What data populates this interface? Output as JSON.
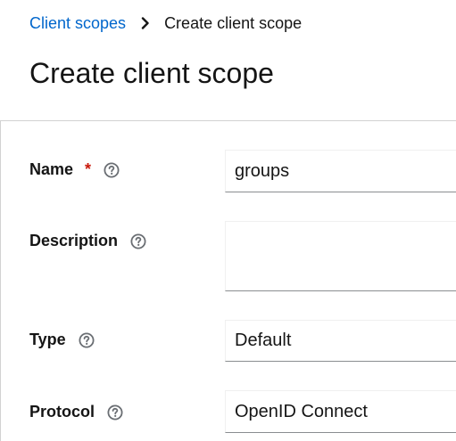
{
  "breadcrumb": {
    "parent": "Client scopes",
    "current": "Create client scope",
    "separator_icon": "chevron-right-icon"
  },
  "page_title": "Create client scope",
  "form": {
    "name": {
      "label": "Name",
      "required_marker": "*",
      "value": "groups",
      "help_icon": "help-icon"
    },
    "description": {
      "label": "Description",
      "value": "",
      "help_icon": "help-icon"
    },
    "type": {
      "label": "Type",
      "value": "Default",
      "help_icon": "help-icon"
    },
    "protocol": {
      "label": "Protocol",
      "value": "OpenID Connect",
      "help_icon": "help-icon"
    }
  },
  "colors": {
    "link": "#0066cc",
    "required": "#c9190b",
    "text": "#151515"
  }
}
